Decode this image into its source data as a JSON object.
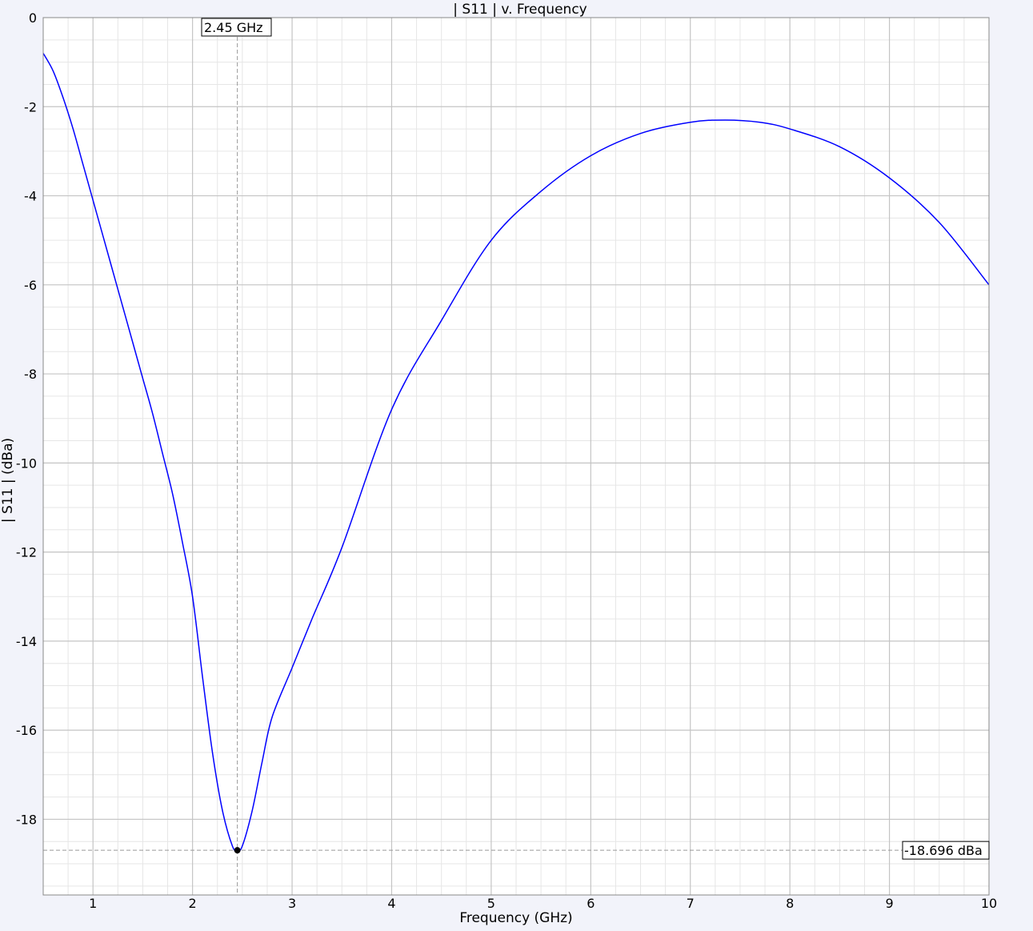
{
  "chart_data": {
    "type": "line",
    "title": "| S11 | v. Frequency",
    "xlabel": "Frequency (GHz)",
    "ylabel": "| S11 | (dBa)",
    "xlim": [
      0.5,
      10
    ],
    "ylim": [
      -19.7,
      0
    ],
    "x_ticks": [
      "1",
      "2",
      "3",
      "4",
      "5",
      "6",
      "7",
      "8",
      "9",
      "10"
    ],
    "y_ticks": [
      "0",
      "-2",
      "-4",
      "-6",
      "-8",
      "-10",
      "-12",
      "-14",
      "-16",
      "-18"
    ],
    "grid": true,
    "series": [
      {
        "name": "",
        "color": "#0000ff",
        "points": [
          [
            0.5,
            -0.8
          ],
          [
            0.6,
            -1.2
          ],
          [
            0.7,
            -1.8
          ],
          [
            0.8,
            -2.5
          ],
          [
            0.9,
            -3.3
          ],
          [
            1.0,
            -4.1
          ],
          [
            1.1,
            -4.9
          ],
          [
            1.2,
            -5.7
          ],
          [
            1.3,
            -6.5
          ],
          [
            1.4,
            -7.3
          ],
          [
            1.5,
            -8.1
          ],
          [
            1.6,
            -8.9
          ],
          [
            1.7,
            -9.8
          ],
          [
            1.8,
            -10.7
          ],
          [
            1.9,
            -11.8
          ],
          [
            2.0,
            -13.0
          ],
          [
            2.1,
            -14.8
          ],
          [
            2.2,
            -16.5
          ],
          [
            2.3,
            -17.8
          ],
          [
            2.4,
            -18.6
          ],
          [
            2.45,
            -18.7
          ],
          [
            2.5,
            -18.6
          ],
          [
            2.6,
            -17.8
          ],
          [
            2.7,
            -16.7
          ],
          [
            2.8,
            -15.7
          ],
          [
            3.0,
            -14.6
          ],
          [
            3.2,
            -13.5
          ],
          [
            3.5,
            -11.9
          ],
          [
            4.0,
            -8.8
          ],
          [
            4.5,
            -6.8
          ],
          [
            5.0,
            -5.0
          ],
          [
            5.5,
            -3.9
          ],
          [
            6.0,
            -3.1
          ],
          [
            6.5,
            -2.6
          ],
          [
            7.0,
            -2.35
          ],
          [
            7.35,
            -2.3
          ],
          [
            7.7,
            -2.35
          ],
          [
            8.0,
            -2.5
          ],
          [
            8.5,
            -2.9
          ],
          [
            9.0,
            -3.6
          ],
          [
            9.5,
            -4.6
          ],
          [
            10.0,
            -6.0
          ]
        ]
      }
    ],
    "markers": {
      "x_value": 2.45,
      "x_label": "2.45 GHz",
      "y_value": -18.696,
      "y_label": "-18.696 dBa"
    }
  }
}
